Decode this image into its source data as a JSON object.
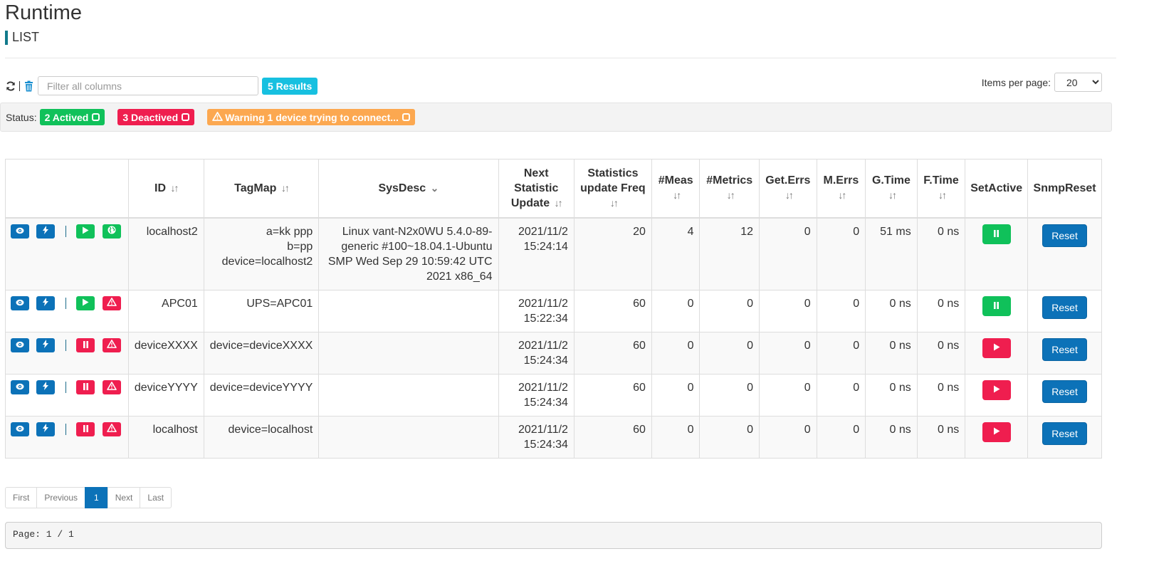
{
  "header": {
    "title": "Runtime",
    "subtitle": "LIST"
  },
  "toolbar": {
    "refresh_icon": "refresh-icon",
    "delete_icon": "trash-icon",
    "filter_placeholder": "Filter all columns",
    "filter_value": "",
    "results": "5 Results",
    "items_per_page_label": "Items per page:",
    "items_per_page_value": "20"
  },
  "status": {
    "label": "Status:",
    "actived": "2 Actived",
    "deactived": "3 Deactived",
    "warning": "Warning 1 device trying to connect...",
    "colors": {
      "actived": "#10c15a",
      "deactived": "#ef1e4f",
      "warning": "#fca850"
    }
  },
  "table": {
    "headers": [
      "",
      "ID",
      "TagMap",
      "SysDesc",
      "Next Statistic Update",
      "Statistics update Freq",
      "#Meas",
      "#Metrics",
      "Get.Errs",
      "M.Errs",
      "G.Time",
      "F.Time",
      "SetActive",
      "SnmpReset"
    ],
    "rows": [
      {
        "id": "localhost2",
        "tagmap": [
          "a=kk ppp",
          "b=pp",
          "device=localhost2"
        ],
        "sysdesc": "Linux vant-N2x0WU 5.4.0-89-generic #100~18.04.1-Ubuntu SMP Wed Sep 29 10:59:42 UTC 2021 x86_64",
        "next_update": [
          "2021/11/2",
          "15:24:14"
        ],
        "freq": "20",
        "meas": "4",
        "metrics": "12",
        "get_errs": "0",
        "m_errs": "0",
        "g_time": "51 ms",
        "f_time": "0 ns",
        "active": true,
        "state_icon": "play-icon",
        "conn_icon": "globe-icon",
        "reset": "Reset"
      },
      {
        "id": "APC01",
        "tagmap": [
          "UPS=APC01"
        ],
        "sysdesc": "",
        "next_update": [
          "2021/11/2",
          "15:22:34"
        ],
        "freq": "60",
        "meas": "0",
        "metrics": "0",
        "get_errs": "0",
        "m_errs": "0",
        "g_time": "0 ns",
        "f_time": "0 ns",
        "active": true,
        "state_icon": "play-icon",
        "conn_icon": "warning-icon",
        "reset": "Reset"
      },
      {
        "id": "deviceXXXX",
        "tagmap": [
          "device=deviceXXXX"
        ],
        "sysdesc": "",
        "next_update": [
          "2021/11/2",
          "15:24:34"
        ],
        "freq": "60",
        "meas": "0",
        "metrics": "0",
        "get_errs": "0",
        "m_errs": "0",
        "g_time": "0 ns",
        "f_time": "0 ns",
        "active": false,
        "state_icon": "pause-icon",
        "conn_icon": "warning-icon",
        "reset": "Reset"
      },
      {
        "id": "deviceYYYY",
        "tagmap": [
          "device=deviceYYYY"
        ],
        "sysdesc": "",
        "next_update": [
          "2021/11/2",
          "15:24:34"
        ],
        "freq": "60",
        "meas": "0",
        "metrics": "0",
        "get_errs": "0",
        "m_errs": "0",
        "g_time": "0 ns",
        "f_time": "0 ns",
        "active": false,
        "state_icon": "pause-icon",
        "conn_icon": "warning-icon",
        "reset": "Reset"
      },
      {
        "id": "localhost",
        "tagmap": [
          "device=localhost"
        ],
        "sysdesc": "",
        "next_update": [
          "2021/11/2",
          "15:24:34"
        ],
        "freq": "60",
        "meas": "0",
        "metrics": "0",
        "get_errs": "0",
        "m_errs": "0",
        "g_time": "0 ns",
        "f_time": "0 ns",
        "active": false,
        "state_icon": "pause-icon",
        "conn_icon": "warning-icon",
        "reset": "Reset"
      }
    ]
  },
  "pagination": {
    "first": "First",
    "previous": "Previous",
    "current": "1",
    "next": "Next",
    "last": "Last"
  },
  "page_info": "Page: 1 / 1"
}
